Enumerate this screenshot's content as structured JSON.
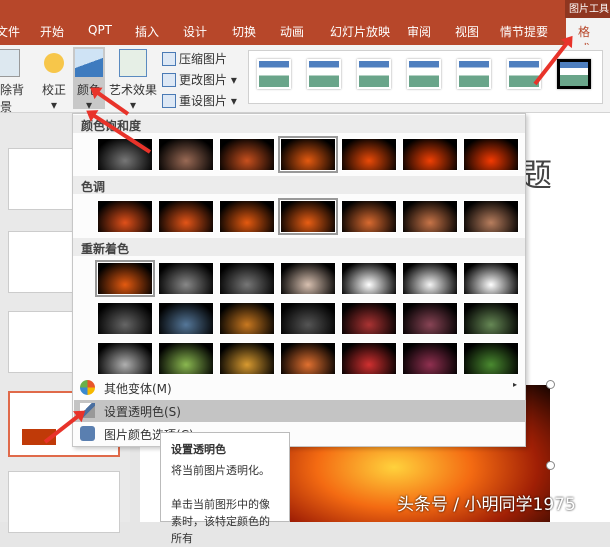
{
  "titlebar": {
    "context": "图片工具"
  },
  "tabs": [
    "文件",
    "开始",
    "QPT",
    "插入",
    "设计",
    "切换",
    "动画",
    "幻灯片放映",
    "审阅",
    "视图",
    "情节提要",
    "格式"
  ],
  "ribbon": {
    "remove_bg": "删除背景",
    "corrections": "校正",
    "color": "颜色",
    "artistic": "艺术效果",
    "compress": "压缩图片",
    "change": "更改图片 ▾",
    "reset": "重设图片 ▾"
  },
  "menu": {
    "sections": [
      "颜色饱和度",
      "色调",
      "重新着色"
    ],
    "saturation": [
      "#777777",
      "#9a6a55",
      "#c8501e",
      "#e45a10",
      "#ea4a08",
      "#f04004",
      "#f43a02"
    ],
    "tone": [
      "#e0501a",
      "#e35518",
      "#e45a10",
      "#e85e14",
      "#d86a30",
      "#c77448",
      "#b87e5e"
    ],
    "recolor": [
      [
        "#e45a10",
        "#888888",
        "#777777",
        "#d8c0b0",
        "#ffffff",
        "#f4f4f4",
        "#ffffff"
      ],
      [
        "#666666",
        "#557799",
        "#c87820",
        "#555555",
        "#aa3333",
        "#884455",
        "#668855"
      ],
      [
        "#b0b0b0",
        "#8ab850",
        "#d89a30",
        "#e07030",
        "#d03030",
        "#903050",
        "#4a8a30"
      ]
    ],
    "items": [
      {
        "label": "其他变体(M)",
        "arrow": "▸"
      },
      {
        "label": "设置透明色(S)"
      },
      {
        "label": "图片颜色选项(C)..."
      }
    ],
    "accent": "#b7472a"
  },
  "slide": {
    "title": "题"
  },
  "tooltip": {
    "title": "设置透明色",
    "line1": "将当前图片透明化。",
    "line2": "单击当前图形中的像素时，该特定颜色的所有"
  },
  "watermark": "头条号 / 小明同学1975"
}
